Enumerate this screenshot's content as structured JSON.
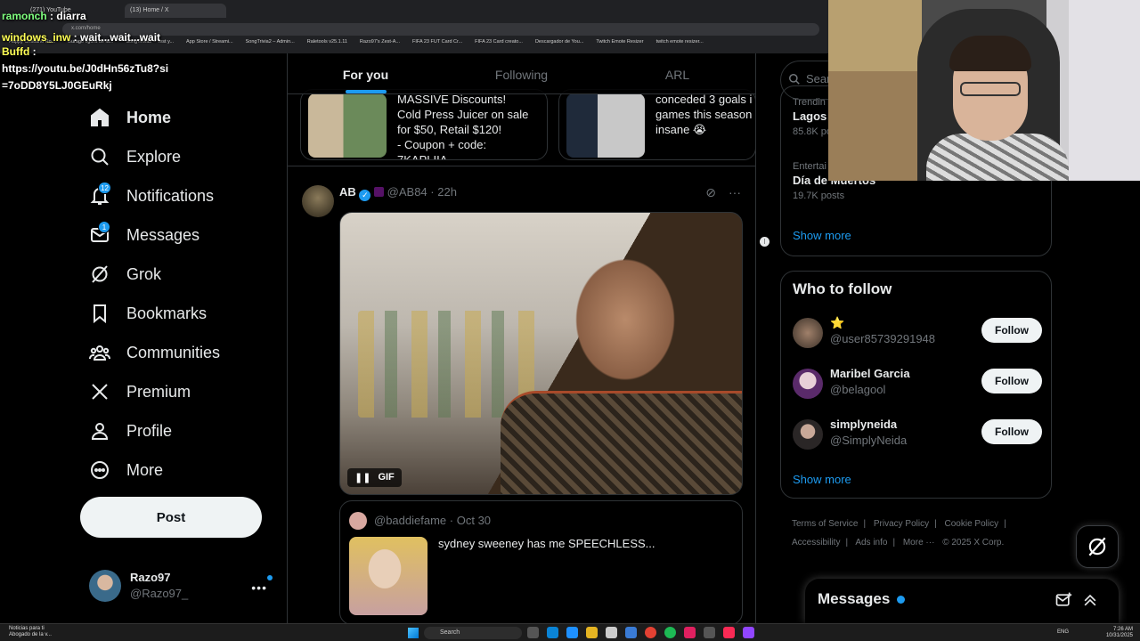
{
  "browser": {
    "tabs": [
      {
        "label": "(271) YouTube"
      },
      {
        "label": "(13) Home / X"
      }
    ],
    "url": "x.com/home",
    "bookmarks": [
      "Happy Cristiano Ro...",
      "Burago figura de la...",
      "SongTrivia2 – Test y...",
      "App Store / Streami...",
      "SongTrivia2 – Admin...",
      "Raletools v25.1.11",
      "Razo97's Zest-A...",
      "FIFA 23 FUT Card Cr...",
      "FIFA 23 Card creato...",
      "Descargador de You...",
      "Twitch Emote Resizer",
      "twitch emote resizer..."
    ]
  },
  "chat": [
    {
      "user": "ramonch",
      "message": "diarra"
    },
    {
      "user": "windows_inw",
      "message": "wait...wait...wait"
    },
    {
      "user": "Buffd",
      "message": "https://youtu.be/J0dHn56zTu8?si=7oDD8Y5LJ0GEuRkj"
    }
  ],
  "nav": {
    "items": [
      {
        "label": "Home",
        "icon": "home-icon"
      },
      {
        "label": "Explore",
        "icon": "search-icon"
      },
      {
        "label": "Notifications",
        "icon": "bell-icon",
        "badge": "12"
      },
      {
        "label": "Messages",
        "icon": "envelope-icon",
        "badge": "1"
      },
      {
        "label": "Grok",
        "icon": "grok-icon"
      },
      {
        "label": "Bookmarks",
        "icon": "bookmark-icon"
      },
      {
        "label": "Communities",
        "icon": "communities-icon"
      },
      {
        "label": "Premium",
        "icon": "x-logo-icon"
      },
      {
        "label": "Profile",
        "icon": "person-icon"
      },
      {
        "label": "More",
        "icon": "more-circle-icon"
      }
    ],
    "post_label": "Post"
  },
  "account": {
    "name": "Razo97",
    "handle": "@Razo97_"
  },
  "feed": {
    "tabs": [
      "For you",
      "Following",
      "ARL"
    ],
    "promo_cards": [
      {
        "text": "MASSIVE Discounts!\nCold Press Juicer on sale\nfor $50, Retail $120!\n- Coupon + code:\n7KAPLIIA"
      },
      {
        "text": "conceded 3 goals i\ngames this season\ninsane 😭"
      }
    ],
    "tweet": {
      "name": "AB",
      "handle": "@AB84",
      "time": "22h",
      "media_badge": "GIF",
      "quote": {
        "handle": "@baddiefame",
        "time": "Oct 30",
        "text": "sydney sweeney has me SPEECHLESS..."
      }
    }
  },
  "right": {
    "search_placeholder": "Sear",
    "trends": [
      {
        "category": "Trendin",
        "title": "Lagos",
        "count": "85.8K po"
      },
      {
        "category": "Entertai",
        "title": "Día de Muertos",
        "count": "19.7K posts"
      }
    ],
    "show_more": "Show more",
    "who_to_follow_title": "Who to follow",
    "who_to_follow": [
      {
        "name": "⭐",
        "handle": "@user85739291948",
        "button": "Follow"
      },
      {
        "name": "Maribel Garcia",
        "handle": "@belagool",
        "button": "Follow"
      },
      {
        "name": "simplyneida",
        "handle": "@SimplyNeida",
        "button": "Follow"
      }
    ],
    "footer": [
      "Terms of Service",
      "|",
      "Privacy Policy",
      "|",
      "Cookie Policy",
      "|",
      "Accessibility",
      "|",
      "Ads info",
      "|",
      "More ···",
      "© 2025 X Corp."
    ]
  },
  "messages_dock": {
    "title": "Messages"
  },
  "taskbar": {
    "news_title": "Noticias para ti",
    "news_sub": "Abogado de la v...",
    "search": "Search",
    "lang": "ENG",
    "time": "7:26 AM",
    "date": "10/31/2025"
  }
}
